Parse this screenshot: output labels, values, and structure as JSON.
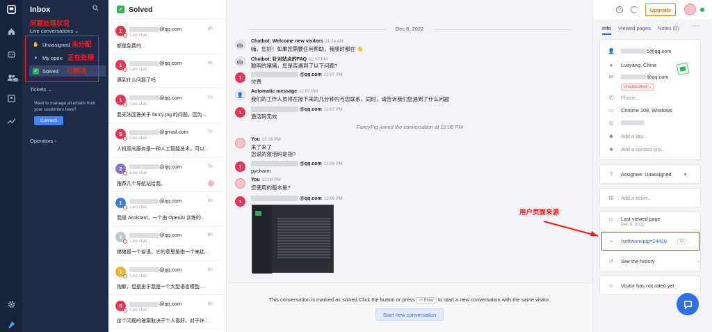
{
  "nav": {
    "title": "Inbox",
    "subtitle": "Live conversations ⌄",
    "items": [
      {
        "label": "Unassigned",
        "icon": "wave-hand-icon"
      },
      {
        "label": "My open",
        "icon": "person-icon"
      },
      {
        "label": "Solved",
        "icon": "checkbox-icon"
      }
    ],
    "tickets": "Tickets ⌄",
    "email_msg": "Want to manage all emails from your customers here?",
    "connect": "Connect",
    "operators": "Operators ›",
    "badge": "49"
  },
  "annotations": {
    "status": "问题处理状况",
    "unassigned": "未分配",
    "in_progress": "正在处理",
    "solved": "已解决",
    "source": "用户页面来源"
  },
  "list": {
    "title": "Solved",
    "live": "Live chat",
    "items": [
      {
        "num": "1",
        "color": "#e8344f",
        "email": "@qq.com",
        "time": "4h",
        "preview": "都是免费的"
      },
      {
        "num": "1",
        "color": "#e8344f",
        "email": "@qq.com",
        "time": "4h",
        "preview": "遇到什么问题了吗"
      },
      {
        "num": "1",
        "color": "#e8344f",
        "email": "@qq.com",
        "time": "7h",
        "preview": "我无法回答关于 fancy pig 的问题，因为..."
      },
      {
        "num": "S",
        "color": "#e8344f",
        "email": "@gmail.com",
        "time": "7h",
        "preview": "人机双向服务是一种人工智能技术，可以..."
      },
      {
        "num": "2",
        "color": "#8a6fd1",
        "email": "@qq.com",
        "time": "7h",
        "preview": "推荐几个导航站给我。"
      },
      {
        "num": "1",
        "color": "#3a7fd5",
        "email": "@qq.com",
        "time": "8h",
        "preview": "我是 Assistant，一个由 OpenAI 训练的..."
      },
      {
        "num": "1",
        "color": "#bfc5cc",
        "email": "@qq.com",
        "time": "8h",
        "preview": "猪猪是一个俗语，它的意思是指一个笨拙..."
      },
      {
        "num": "1",
        "color": "#f0b330",
        "email": "@qq.com",
        "time": "8h",
        "preview": "抱歉，但是由于我是一个大型语言模型..."
      },
      {
        "num": "6",
        "color": "#e8344f",
        "email": "@qq.com",
        "time": "8h",
        "preview": "这个问题的答案取决于个人喜好。对于许..."
      }
    ]
  },
  "chat": {
    "date": "Dec 8, 2022",
    "messages": [
      {
        "who": "Chatbot: Welcome new visitors",
        "time": "11:24 AM",
        "lines": [
          "嗨，您好！如果您需要任何帮助，我随时都在 👋"
        ]
      },
      {
        "who": "Chatbot: 针对站点的FAQ",
        "time": "12:07 PM",
        "lines": [
          "聪明的猪猪，您是否遇到了以下问题?"
        ]
      },
      {
        "who": "@qq.com",
        "time": "12:07 PM",
        "lines": [
          "付费"
        ]
      },
      {
        "who": "Automatic message",
        "time": "12:07 PM",
        "lines": [
          "我们的工作人员将在接下来的几分钟内与您联系，同时，请告诉我们您遇到了什么问题"
        ]
      },
      {
        "who": "@qq.com",
        "time": "12:07 PM",
        "lines": [
          "激活码无效"
        ]
      },
      {
        "who": "You",
        "time": "12:08 PM",
        "lines": [
          "来了来了",
          "您说的激活码是指?"
        ]
      },
      {
        "who": "@qq.com",
        "time": "12:08 PM",
        "lines": [
          "pycharm"
        ]
      },
      {
        "who": "You",
        "time": "12:08 PM",
        "lines": [
          "您使用的版本是?"
        ]
      },
      {
        "who": "@qq.com",
        "time": "12:09 PM",
        "lines": [
          ""
        ]
      }
    ],
    "system": "FancyPig joined the conversation at 12:08 PM",
    "solved_pre": "This conversation is marked as solved.Click the button or press",
    "enter": "⏎ Enter",
    "solved_post": "to start a new conversation with the same visitor.",
    "start_btn": "Start new conversation"
  },
  "right": {
    "upgrade": "Upgrade",
    "tabs": [
      "Info",
      "Viewed pages",
      "Notes (0)"
    ],
    "email": "5@qq.com",
    "location": "Luoyang, China",
    "email2": "@qq.com",
    "unsubscribed": "Unsubscribed ⌄",
    "phone": "Phone...",
    "browser": "Chrome 108, Windows",
    "add_tag": "Add a tag...",
    "add_contact": "Add a contact pro...",
    "assignee": "Assignee: Unassigned",
    "add_ticket": "Add a ticket...",
    "last_viewed": "Last viewed page",
    "last_viewed_date": "Dec 8, 2022",
    "page_url": "/software/pig=24426",
    "page_count": "32",
    "history": "See the history",
    "rating": "Visitor has not rated yet"
  }
}
